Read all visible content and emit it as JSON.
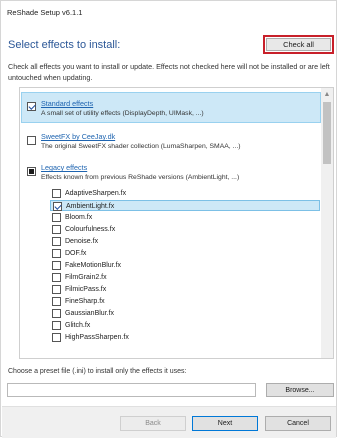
{
  "window": {
    "title": "ReShade Setup v6.1.1"
  },
  "header": {
    "heading": "Select effects to install:",
    "check_all_label": "Check all",
    "description": "Check all effects you want to install or update. Effects not checked here will not be installed or are left untouched when updating."
  },
  "groups": [
    {
      "title": "Standard effects",
      "desc": "A small set of utility effects (DisplayDepth, UIMask, ...)",
      "state": "checked"
    },
    {
      "title": "SweetFX by CeeJay.dk",
      "desc": "The original SweetFX shader collection (LumaSharpen, SMAA, ...)",
      "state": "unchecked"
    },
    {
      "title": "Legacy effects",
      "desc": "Effects known from previous ReShade versions (AmbientLight, ...)",
      "state": "indeterminate"
    }
  ],
  "effects": [
    {
      "label": "AdaptiveSharpen.fx",
      "checked": false
    },
    {
      "label": "AmbientLight.fx",
      "checked": true
    },
    {
      "label": "Bloom.fx",
      "checked": false
    },
    {
      "label": "Colourfulness.fx",
      "checked": false
    },
    {
      "label": "Denoise.fx",
      "checked": false
    },
    {
      "label": "DOF.fx",
      "checked": false
    },
    {
      "label": "FakeMotionBlur.fx",
      "checked": false
    },
    {
      "label": "FilmGrain2.fx",
      "checked": false
    },
    {
      "label": "FilmicPass.fx",
      "checked": false
    },
    {
      "label": "FineSharp.fx",
      "checked": false
    },
    {
      "label": "GaussianBlur.fx",
      "checked": false
    },
    {
      "label": "Glitch.fx",
      "checked": false
    },
    {
      "label": "HighPassSharpen.fx",
      "checked": false
    }
  ],
  "preset": {
    "label": "Choose a preset file (.ini) to install only the effects it uses:",
    "value": "",
    "browse_label": "Browse..."
  },
  "footer": {
    "back_label": "Back",
    "next_label": "Next",
    "cancel_label": "Cancel"
  },
  "colors": {
    "accent": "#2b5797",
    "highlight": "#c8202a",
    "selection": "#cde8f7"
  }
}
